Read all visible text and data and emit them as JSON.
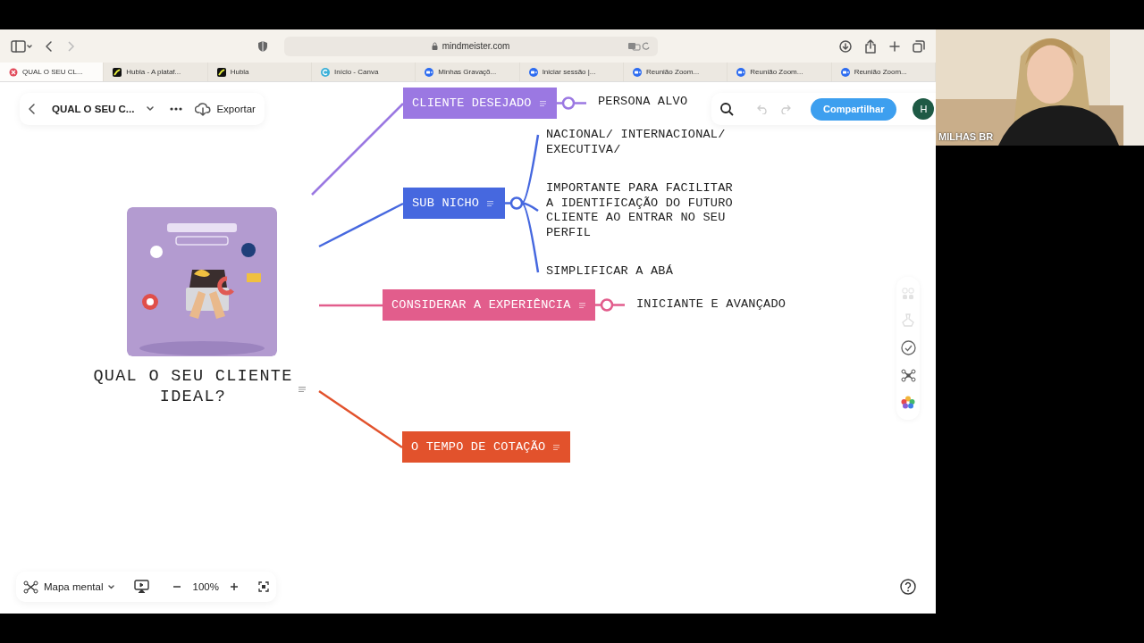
{
  "browser": {
    "url": "mindmeister.com",
    "tabs": [
      {
        "label": "QUAL O SEU CL...",
        "kind": "mindmeister",
        "selected": true
      },
      {
        "label": "Hubla - A plataf...",
        "kind": "hubla",
        "selected": false
      },
      {
        "label": "Hubla",
        "kind": "hubla",
        "selected": false
      },
      {
        "label": "Início - Canva",
        "kind": "canva",
        "selected": false
      },
      {
        "label": "Minhas Gravaçõ...",
        "kind": "zoom",
        "selected": false
      },
      {
        "label": "Iniciar sessão |...",
        "kind": "zoom",
        "selected": false
      },
      {
        "label": "Reunião Zoom...",
        "kind": "zoom",
        "selected": false
      },
      {
        "label": "Reunião Zoom...",
        "kind": "zoom",
        "selected": false
      },
      {
        "label": "Reunião Zoom...",
        "kind": "zoom",
        "selected": false
      }
    ]
  },
  "header": {
    "title": "QUAL O SEU C...",
    "export": "Exportar",
    "share": "Compartilhar",
    "avatar": "H"
  },
  "mind_map": {
    "root": {
      "label": "QUAL O SEU CLIENTE IDEAL?",
      "kind": "picture"
    },
    "branches": [
      {
        "label": "CLIENTE DESEJADO",
        "color": "#9b78e2",
        "children": [
          {
            "label": "PERSONA ALVO"
          }
        ]
      },
      {
        "label": "SUB NICHO",
        "color": "#4668df",
        "children": [
          {
            "label": "NACIONAL/ INTERNACIONAL/ EXECUTIVA/"
          },
          {
            "label": "IMPORTANTE PARA FACILITAR A IDENTIFICAÇÃO DO FUTURO CLIENTE AO ENTRAR NO SEU PERFIL"
          },
          {
            "label": "SIMPLIFICAR A ABÁ"
          }
        ]
      },
      {
        "label": "CONSIDERAR A EXPERIÊNCIA",
        "color": "#e25d8c",
        "children": [
          {
            "label": "INICIANTE E AVANÇADO"
          }
        ]
      },
      {
        "label": "O TEMPO DE COTAÇÃO",
        "color": "#e2522c"
      }
    ]
  },
  "footer": {
    "view": "Mapa mental",
    "zoom": "100%"
  },
  "webcam": {
    "name": "MILHAS BR"
  }
}
